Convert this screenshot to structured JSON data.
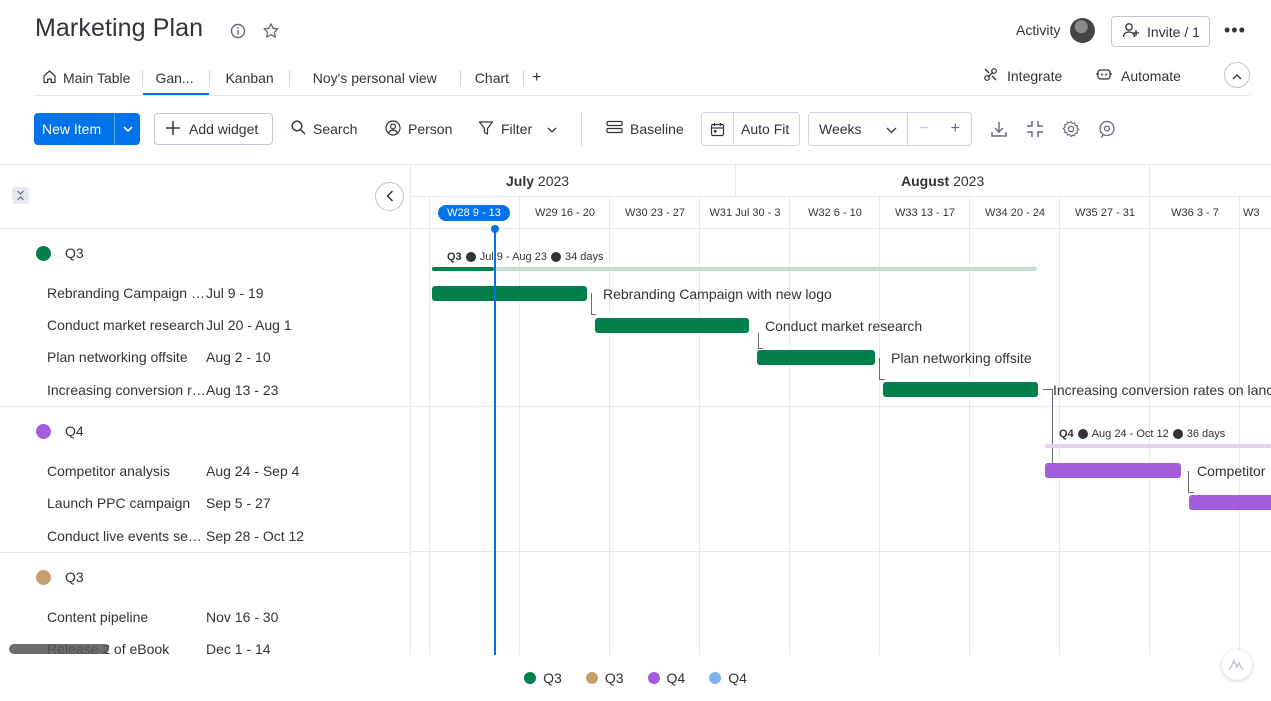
{
  "header": {
    "title": "Marketing Plan",
    "activity_label": "Activity",
    "invite_label": "Invite / 1",
    "more_label": "•••"
  },
  "tabs": [
    {
      "label": "Main Table",
      "icon": "home-icon"
    },
    {
      "label": "Gan...",
      "active": true
    },
    {
      "label": "Kanban"
    },
    {
      "label": "Noy's personal view"
    },
    {
      "label": "Chart"
    },
    {
      "label": "+"
    }
  ],
  "tab_actions": {
    "integrate_label": "Integrate",
    "automate_label": "Automate"
  },
  "toolbar": {
    "new_item_label": "New Item",
    "add_widget_label": "Add widget",
    "search_label": "Search",
    "person_label": "Person",
    "filter_label": "Filter",
    "baseline_label": "Baseline",
    "autofit_label": "Auto Fit",
    "zoom_select_value": "Weeks",
    "zoom_out": "−",
    "zoom_in": "+"
  },
  "timeline": {
    "months": [
      {
        "label": "July",
        "year": "2023"
      },
      {
        "label": "August",
        "year": "2023"
      }
    ],
    "weeks": [
      "W28 9 - 13",
      "W29 16 - 20",
      "W30 23 - 27",
      "W31 Jul 30 - 3",
      "W32 6 - 10",
      "W33 13 - 17",
      "W34 20 - 24",
      "W35 27 - 31",
      "W36 3 - 7",
      "W3"
    ],
    "current_week_index": 0
  },
  "groups": [
    {
      "name": "Q3",
      "color": "#037f4c",
      "summary": {
        "name": "Q3",
        "range": "Jul 9 - Aug 23",
        "duration": "34 days"
      },
      "items": [
        {
          "name": "Rebranding Campaign with new logo",
          "dates": "Jul 9 - 19",
          "bar_label": "Rebranding Campaign with new logo"
        },
        {
          "name": "Conduct market research",
          "dates": "Jul 20 - Aug 1",
          "bar_label": "Conduct market research"
        },
        {
          "name": "Plan networking offsite",
          "dates": "Aug 2 - 10",
          "bar_label": "Plan networking offsite"
        },
        {
          "name": "Increasing conversion rates on landing pages",
          "dates": "Aug 13 - 23",
          "bar_label": "Increasing conversion rates on lanc"
        }
      ]
    },
    {
      "name": "Q4",
      "color": "#a25ddc",
      "summary": {
        "name": "Q4",
        "range": "Aug 24 - Oct 12",
        "duration": "36 days"
      },
      "items": [
        {
          "name": "Competitor analysis",
          "dates": "Aug 24 - Sep 4",
          "bar_label": "Competitor"
        },
        {
          "name": "Launch PPC campaign",
          "dates": "Sep 5 - 27"
        },
        {
          "name": "Conduct live events series",
          "dates": "Sep 28 - Oct 12"
        }
      ]
    },
    {
      "name": "Q3",
      "color": "#c4a06b",
      "items": [
        {
          "name": "Content pipeline",
          "dates": "Nov 16 - 30"
        },
        {
          "name": "Release 2 of eBook",
          "dates": "Dec 1 - 14"
        }
      ]
    }
  ],
  "legend": [
    {
      "label": "Q3",
      "color": "#037f4c"
    },
    {
      "label": "Q3",
      "color": "#c4a06b"
    },
    {
      "label": "Q4",
      "color": "#a25ddc"
    },
    {
      "label": "Q4",
      "color": "#7eb3ee"
    }
  ]
}
